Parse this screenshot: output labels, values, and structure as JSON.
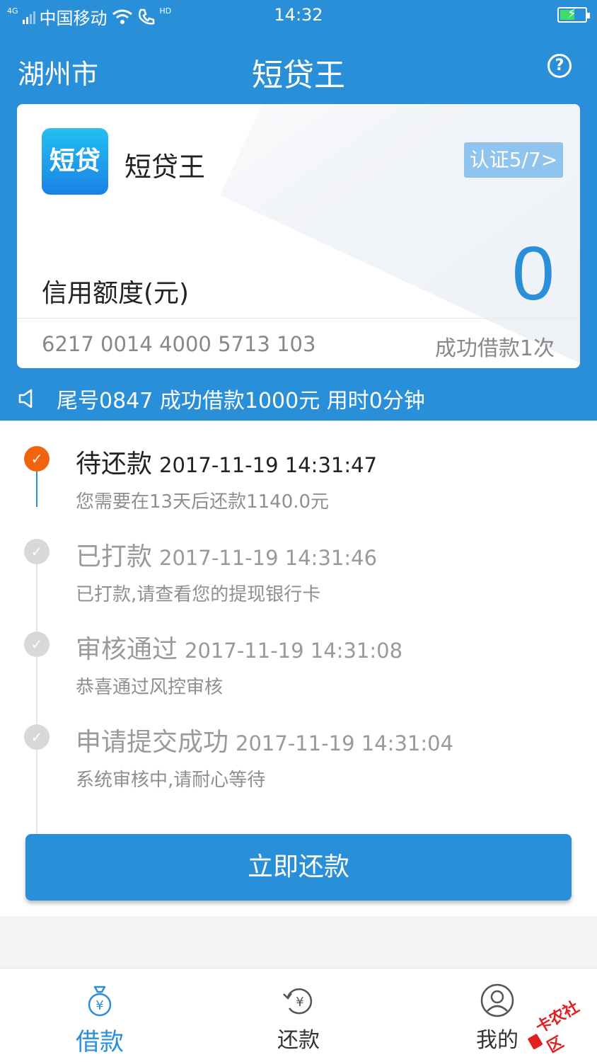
{
  "status_bar": {
    "network": "4G",
    "carrier": "中国移动",
    "hd": "HD",
    "time": "14:32"
  },
  "header": {
    "city": "湖州市",
    "title": "短贷王",
    "help_icon": "question-circle-icon"
  },
  "card": {
    "logo_text": "短贷",
    "app_name": "短贷王",
    "verify_badge": "认证5/7>",
    "credit_label": "信用额度(元)",
    "credit_value": "0",
    "card_number": "6217 0014 4000 5713 103",
    "loan_count": "成功借款1次"
  },
  "notice": {
    "text": "尾号0847 成功借款1000元 用时0分钟"
  },
  "timeline": [
    {
      "status": "待还款",
      "time": "2017-11-19 14:31:47",
      "desc": "您需要在13天后还款1140.0元",
      "active": true
    },
    {
      "status": "已打款",
      "time": "2017-11-19 14:31:46",
      "desc": "已打款,请查看您的提现银行卡",
      "active": false
    },
    {
      "status": "审核通过",
      "time": "2017-11-19 14:31:08",
      "desc": "恭喜通过风控审核",
      "active": false
    },
    {
      "status": "申请提交成功",
      "time": "2017-11-19 14:31:04",
      "desc": "系统审核中,请耐心等待",
      "active": false
    }
  ],
  "repay_button": "立即还款",
  "bottom_nav": {
    "items": [
      {
        "label": "借款",
        "icon": "money-bag-icon",
        "active": true
      },
      {
        "label": "还款",
        "icon": "yen-refresh-icon",
        "active": false
      },
      {
        "label": "我的",
        "icon": "user-icon",
        "active": false
      }
    ]
  },
  "watermark": "卡农社区",
  "colors": {
    "primary": "#2a8fd9",
    "active_dot": "#f0640f",
    "verify_badge": "#8fc4ee",
    "watermark": "#e02020"
  }
}
